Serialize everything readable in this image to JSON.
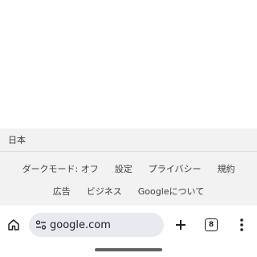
{
  "footer": {
    "country": "日本",
    "row1": [
      "ダークモード: オフ",
      "設定",
      "プライバシー",
      "規約"
    ],
    "row2": [
      "広告",
      "ビジネス",
      "Googleについて"
    ]
  },
  "toolbar": {
    "url": "google.com",
    "tab_count": "8",
    "icons": {
      "home": "home-icon",
      "site": "site-settings-icon",
      "new_tab": "plus-icon",
      "tabs": "tab-switcher-icon",
      "menu": "more-vert-icon"
    }
  }
}
